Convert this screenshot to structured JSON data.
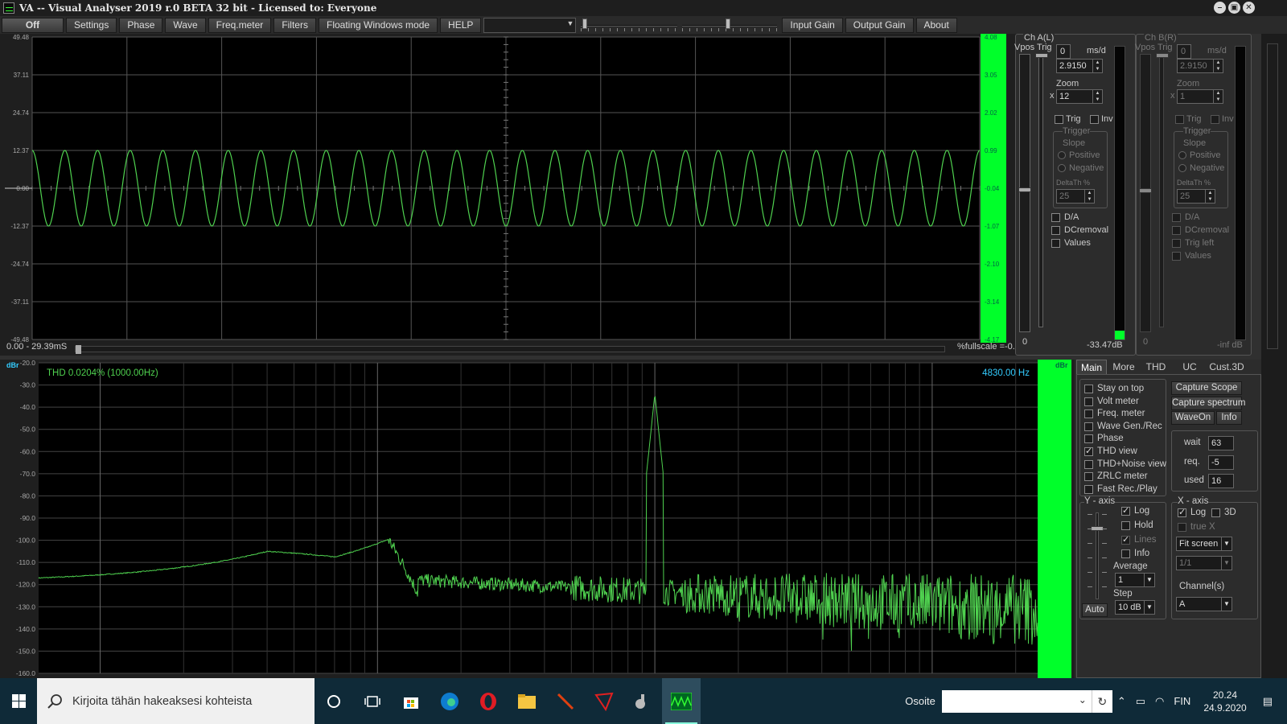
{
  "window": {
    "title": "VA -- Visual Analyser 2019 r.0 BETA 32 bit - Licensed to: Everyone"
  },
  "menu": {
    "off": "Off",
    "settings": "Settings",
    "phase": "Phase",
    "wave": "Wave",
    "freqmeter": "Freq.meter",
    "filters": "Filters",
    "floating": "Floating Windows mode",
    "help": "HELP",
    "input_gain": "Input Gain",
    "output_gain": "Output Gain",
    "about": "About"
  },
  "scope": {
    "y_ticks_left": [
      "49.48",
      "37.11",
      "24.74",
      "12.37",
      "0.00",
      "-12.37",
      "-24.74",
      "-37.11",
      "-49.48"
    ],
    "y_ticks_right": [
      "4.08",
      "3.05",
      "2.02",
      "0.99",
      "-0.04",
      "-1.07",
      "-2.10",
      "-3.14",
      "-4.17"
    ],
    "time_label": "0.00 - 29.39mS",
    "fullscale": "%fullscale =-0.70",
    "trace_color": "#4fd14f",
    "level_color": "#00ff2a",
    "wave": {
      "cycles": 29,
      "amplitude": 12.37,
      "ylim": [
        -49.48,
        49.48
      ]
    }
  },
  "channel_a": {
    "title": "Ch A(L)",
    "vpos_label": "Vpos",
    "trig_label": "Trig",
    "spin0": "0",
    "msd_label": "ms/d",
    "msd_value": "2.9150",
    "zoom_label": "Zoom",
    "zoom_x": "x",
    "zoom_value": "12",
    "trig_chk": "Trig",
    "inv_chk": "Inv",
    "trigger_group": "Trigger",
    "slope_label": "Slope",
    "positive": "Positive",
    "negative": "Negative",
    "deltath_label": "DeltaTh %",
    "deltath_value": "25",
    "da": "D/A",
    "dcremoval": "DCremoval",
    "values": "Values",
    "bottom_zero": "0",
    "db_readout": "-33.47dB",
    "level_fraction": 0.03
  },
  "channel_b": {
    "title": "Ch B(R)",
    "vpos_label": "Vpos",
    "trig_label": "Trig",
    "spin0": "0",
    "msd_label": "ms/d",
    "msd_value": "2.9150",
    "zoom_label": "Zoom",
    "zoom_x": "x",
    "zoom_value": "1",
    "trig_chk": "Trig",
    "inv_chk": "Inv",
    "trigger_group": "Trigger",
    "slope_label": "Slope",
    "positive": "Positive",
    "negative": "Negative",
    "deltath_label": "DeltaTh %",
    "deltath_value": "25",
    "da": "D/A",
    "dcremoval": "DCremoval",
    "trig_left": "Trig left",
    "values": "Values",
    "bottom_zero": "0",
    "db_readout": "-inf dB"
  },
  "spectrum": {
    "unit_left": "dBr",
    "unit_right": "dBr",
    "thd_label": "THD 0.0204% (1000.00Hz)",
    "cursor_freq": "4830.00 Hz",
    "y_ticks": [
      "-20.0",
      "-30.0",
      "-40.0",
      "-50.0",
      "-60.0",
      "-70.0",
      "-80.0",
      "-90.0",
      "-100.0",
      "-110.0",
      "-120.0",
      "-130.0",
      "-140.0",
      "-150.0",
      "-160.0"
    ],
    "trace_color": "#4fd14f",
    "accent_color": "#33ccff",
    "peak_freq_hz": 1000,
    "peak_db": -34
  },
  "controls": {
    "tabs": [
      "Main",
      "More",
      "THD",
      "UC",
      "Cust.3D"
    ],
    "active_tab": "Main",
    "checks": [
      {
        "label": "Stay on top",
        "on": false
      },
      {
        "label": "Volt meter",
        "on": false
      },
      {
        "label": "Freq. meter",
        "on": false
      },
      {
        "label": "Wave Gen./Rec",
        "on": false
      },
      {
        "label": "Phase",
        "on": false
      },
      {
        "label": "THD view",
        "on": true
      },
      {
        "label": "THD+Noise view",
        "on": false
      },
      {
        "label": "ZRLC meter",
        "on": false
      },
      {
        "label": "Fast Rec./Play",
        "on": false
      }
    ],
    "capture_scope": "Capture Scope",
    "capture_spectrum": "Capture spectrum",
    "waveon": "WaveOn",
    "info": "Info",
    "wait_label": "wait",
    "wait_value": "63",
    "req_label": "req.",
    "req_value": "-5",
    "used_label": "used",
    "used_value": "16",
    "yaxis_title": "Y - axis",
    "y_log": "Log",
    "y_hold": "Hold",
    "y_lines": "Lines",
    "y_info": "Info",
    "average_label": "Average",
    "average_value": "1",
    "step_label": "Step",
    "step_value": "10 dB",
    "auto": "Auto",
    "xaxis_title": "X - axis",
    "x_log": "Log",
    "x_3d": "3D",
    "x_truex": "true X",
    "fit_screen": "Fit screen",
    "ratio": "1/1",
    "channels_label": "Channel(s)",
    "channel_value": "A"
  },
  "taskbar": {
    "search_placeholder": "Kirjoita tähän hakeaksesi kohteista",
    "address_label": "Osoite",
    "language": "FIN",
    "time": "20.24",
    "date": "24.9.2020"
  }
}
